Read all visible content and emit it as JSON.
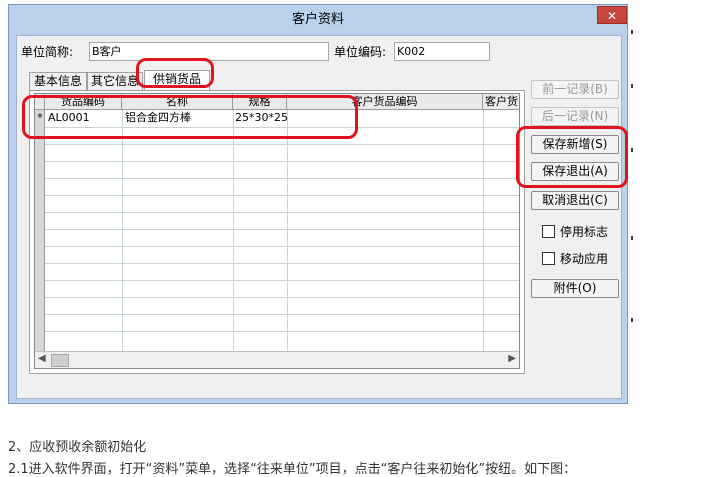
{
  "window": {
    "title": "客户资料",
    "close_icon": "close-icon"
  },
  "form": {
    "unit_short_label": "单位简称:",
    "unit_short_value": "B客户",
    "unit_code_label": "单位编码:",
    "unit_code_value": "K002"
  },
  "tabs": [
    {
      "label": "基本信息",
      "active": false
    },
    {
      "label": "其它信息",
      "active": false
    },
    {
      "label": "供销货品",
      "active": true
    }
  ],
  "grid": {
    "columns": [
      "货品编码",
      "名称",
      "规格",
      "客户货品编码",
      "客户货"
    ],
    "rows": [
      {
        "indicator": "*",
        "code": "AL0001",
        "name": "铝合金四方棒",
        "spec": "25*30*25(",
        "customer_code": "",
        "customer_name": ""
      }
    ]
  },
  "buttons": {
    "prev": "前一记录(B)",
    "next": "后一记录(N)",
    "save_new": "保存新增(S)",
    "save_exit": "保存退出(A)",
    "cancel_exit": "取消退出(C)",
    "attachment": "附件(O)"
  },
  "checkboxes": {
    "disabled_flag": "停用标志",
    "mobile_app": "移动应用"
  },
  "colors": {
    "highlight": "#e0141c",
    "title_bar": "#b9d1ea"
  },
  "article": {
    "heading": "2、应收预收余额初始化",
    "step": "2.1进入软件界面，打开“资料”菜单，选择“往来单位”项目，点击“客户往来初始化”按纽。如下图："
  }
}
